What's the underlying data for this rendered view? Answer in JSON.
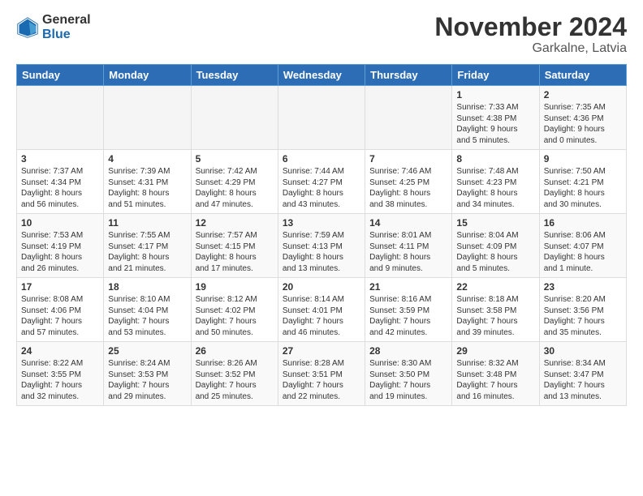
{
  "header": {
    "logo_general": "General",
    "logo_blue": "Blue",
    "month_title": "November 2024",
    "location": "Garkalne, Latvia"
  },
  "days_of_week": [
    "Sunday",
    "Monday",
    "Tuesday",
    "Wednesday",
    "Thursday",
    "Friday",
    "Saturday"
  ],
  "weeks": [
    [
      {
        "day": "",
        "info": ""
      },
      {
        "day": "",
        "info": ""
      },
      {
        "day": "",
        "info": ""
      },
      {
        "day": "",
        "info": ""
      },
      {
        "day": "",
        "info": ""
      },
      {
        "day": "1",
        "info": "Sunrise: 7:33 AM\nSunset: 4:38 PM\nDaylight: 9 hours\nand 5 minutes."
      },
      {
        "day": "2",
        "info": "Sunrise: 7:35 AM\nSunset: 4:36 PM\nDaylight: 9 hours\nand 0 minutes."
      }
    ],
    [
      {
        "day": "3",
        "info": "Sunrise: 7:37 AM\nSunset: 4:34 PM\nDaylight: 8 hours\nand 56 minutes."
      },
      {
        "day": "4",
        "info": "Sunrise: 7:39 AM\nSunset: 4:31 PM\nDaylight: 8 hours\nand 51 minutes."
      },
      {
        "day": "5",
        "info": "Sunrise: 7:42 AM\nSunset: 4:29 PM\nDaylight: 8 hours\nand 47 minutes."
      },
      {
        "day": "6",
        "info": "Sunrise: 7:44 AM\nSunset: 4:27 PM\nDaylight: 8 hours\nand 43 minutes."
      },
      {
        "day": "7",
        "info": "Sunrise: 7:46 AM\nSunset: 4:25 PM\nDaylight: 8 hours\nand 38 minutes."
      },
      {
        "day": "8",
        "info": "Sunrise: 7:48 AM\nSunset: 4:23 PM\nDaylight: 8 hours\nand 34 minutes."
      },
      {
        "day": "9",
        "info": "Sunrise: 7:50 AM\nSunset: 4:21 PM\nDaylight: 8 hours\nand 30 minutes."
      }
    ],
    [
      {
        "day": "10",
        "info": "Sunrise: 7:53 AM\nSunset: 4:19 PM\nDaylight: 8 hours\nand 26 minutes."
      },
      {
        "day": "11",
        "info": "Sunrise: 7:55 AM\nSunset: 4:17 PM\nDaylight: 8 hours\nand 21 minutes."
      },
      {
        "day": "12",
        "info": "Sunrise: 7:57 AM\nSunset: 4:15 PM\nDaylight: 8 hours\nand 17 minutes."
      },
      {
        "day": "13",
        "info": "Sunrise: 7:59 AM\nSunset: 4:13 PM\nDaylight: 8 hours\nand 13 minutes."
      },
      {
        "day": "14",
        "info": "Sunrise: 8:01 AM\nSunset: 4:11 PM\nDaylight: 8 hours\nand 9 minutes."
      },
      {
        "day": "15",
        "info": "Sunrise: 8:04 AM\nSunset: 4:09 PM\nDaylight: 8 hours\nand 5 minutes."
      },
      {
        "day": "16",
        "info": "Sunrise: 8:06 AM\nSunset: 4:07 PM\nDaylight: 8 hours\nand 1 minute."
      }
    ],
    [
      {
        "day": "17",
        "info": "Sunrise: 8:08 AM\nSunset: 4:06 PM\nDaylight: 7 hours\nand 57 minutes."
      },
      {
        "day": "18",
        "info": "Sunrise: 8:10 AM\nSunset: 4:04 PM\nDaylight: 7 hours\nand 53 minutes."
      },
      {
        "day": "19",
        "info": "Sunrise: 8:12 AM\nSunset: 4:02 PM\nDaylight: 7 hours\nand 50 minutes."
      },
      {
        "day": "20",
        "info": "Sunrise: 8:14 AM\nSunset: 4:01 PM\nDaylight: 7 hours\nand 46 minutes."
      },
      {
        "day": "21",
        "info": "Sunrise: 8:16 AM\nSunset: 3:59 PM\nDaylight: 7 hours\nand 42 minutes."
      },
      {
        "day": "22",
        "info": "Sunrise: 8:18 AM\nSunset: 3:58 PM\nDaylight: 7 hours\nand 39 minutes."
      },
      {
        "day": "23",
        "info": "Sunrise: 8:20 AM\nSunset: 3:56 PM\nDaylight: 7 hours\nand 35 minutes."
      }
    ],
    [
      {
        "day": "24",
        "info": "Sunrise: 8:22 AM\nSunset: 3:55 PM\nDaylight: 7 hours\nand 32 minutes."
      },
      {
        "day": "25",
        "info": "Sunrise: 8:24 AM\nSunset: 3:53 PM\nDaylight: 7 hours\nand 29 minutes."
      },
      {
        "day": "26",
        "info": "Sunrise: 8:26 AM\nSunset: 3:52 PM\nDaylight: 7 hours\nand 25 minutes."
      },
      {
        "day": "27",
        "info": "Sunrise: 8:28 AM\nSunset: 3:51 PM\nDaylight: 7 hours\nand 22 minutes."
      },
      {
        "day": "28",
        "info": "Sunrise: 8:30 AM\nSunset: 3:50 PM\nDaylight: 7 hours\nand 19 minutes."
      },
      {
        "day": "29",
        "info": "Sunrise: 8:32 AM\nSunset: 3:48 PM\nDaylight: 7 hours\nand 16 minutes."
      },
      {
        "day": "30",
        "info": "Sunrise: 8:34 AM\nSunset: 3:47 PM\nDaylight: 7 hours\nand 13 minutes."
      }
    ]
  ]
}
